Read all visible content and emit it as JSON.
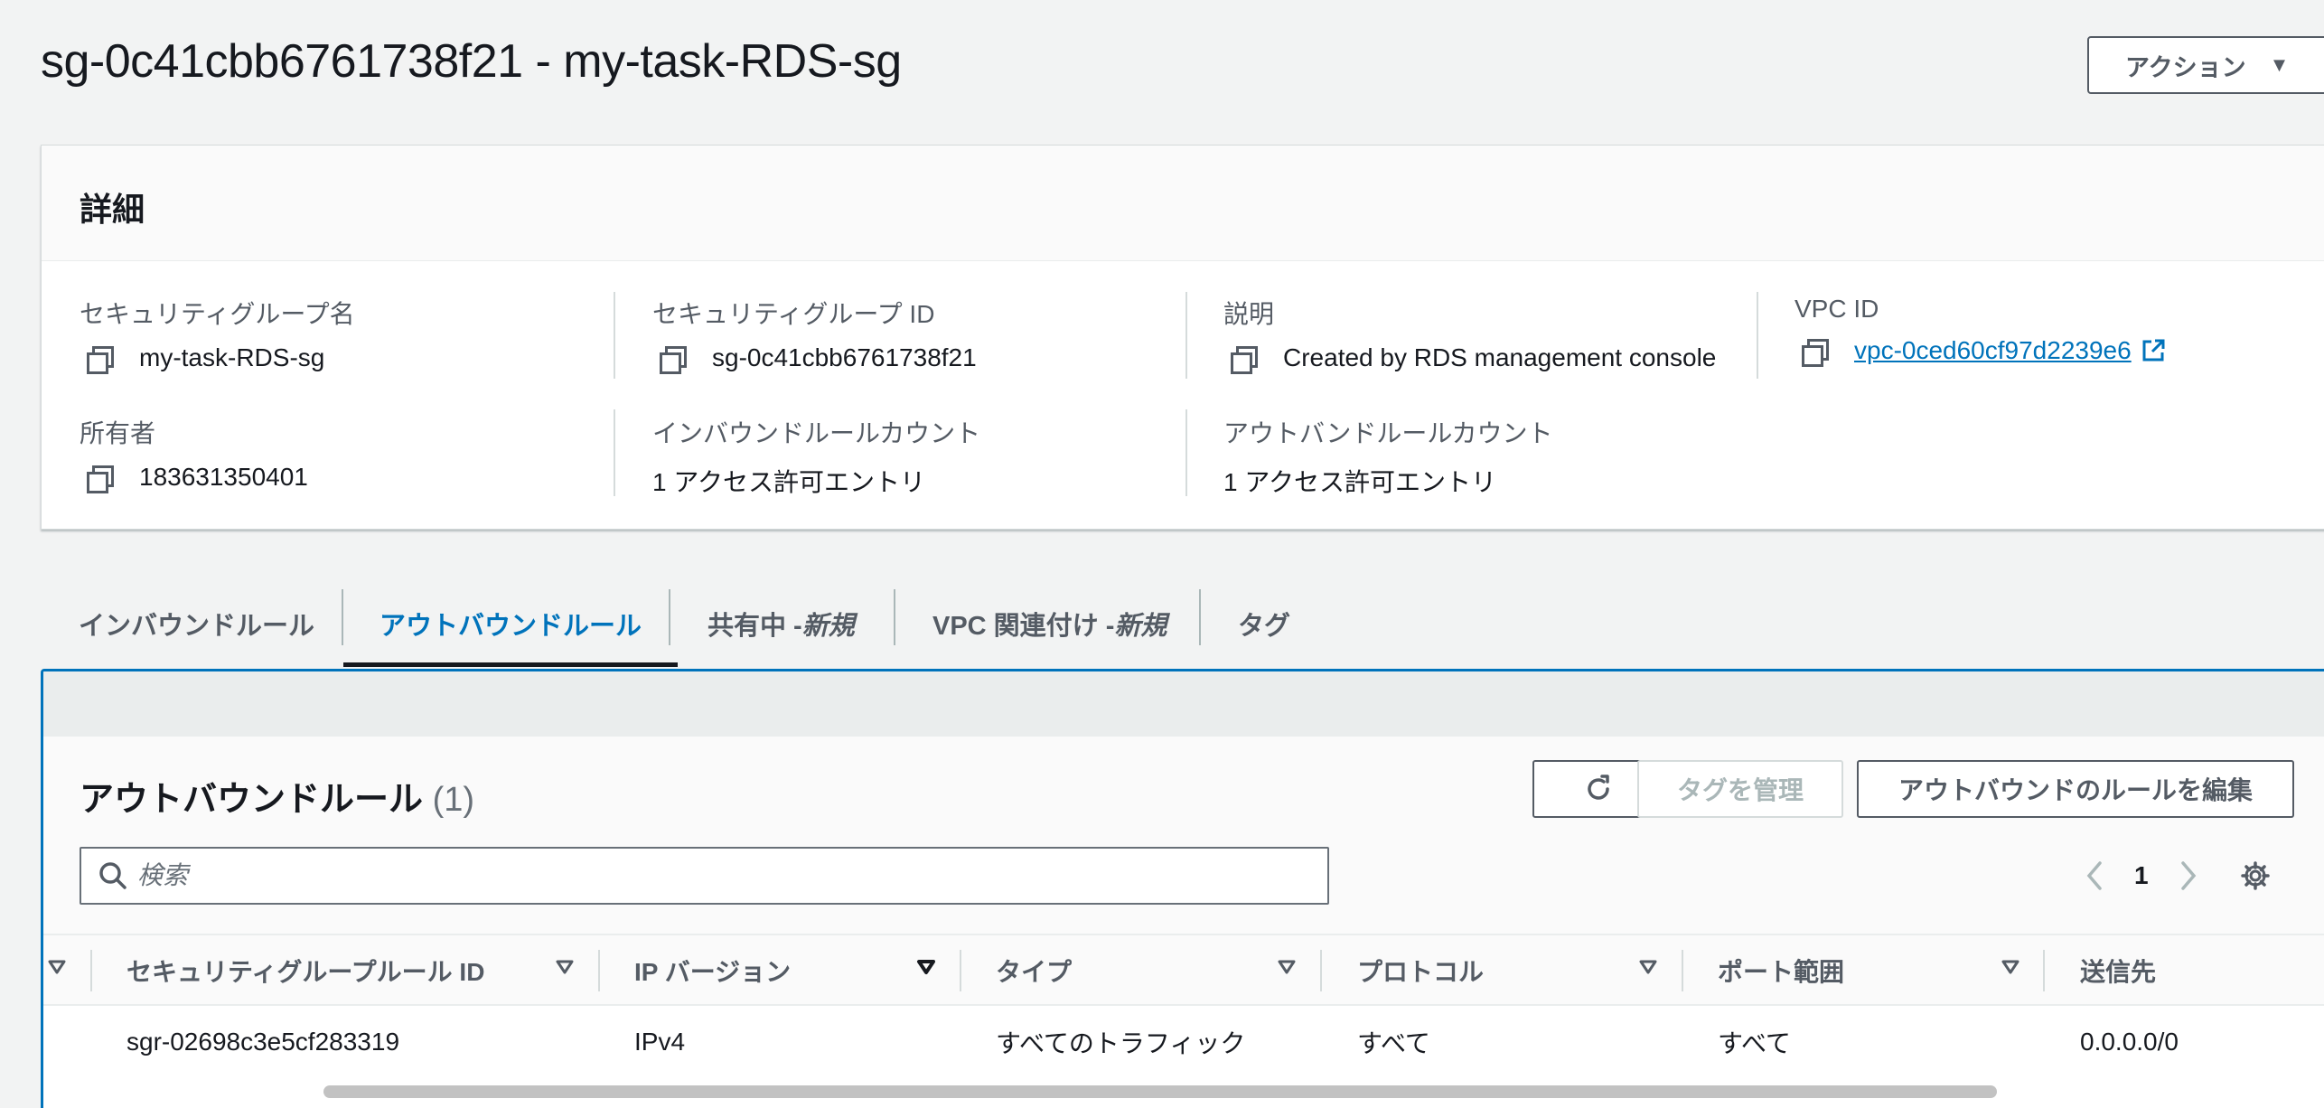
{
  "page": {
    "title": "sg-0c41cbb6761738f21 - my-task-RDS-sg"
  },
  "actions_button": {
    "label": "アクション"
  },
  "details": {
    "heading": "詳細",
    "fields": [
      {
        "label": "セキュリティグループ名",
        "value": "my-task-RDS-sg"
      },
      {
        "label": "セキュリティグループ ID",
        "value": "sg-0c41cbb6761738f21"
      },
      {
        "label": "説明",
        "value": "Created by RDS management console"
      },
      {
        "label": "VPC ID",
        "value": "vpc-0ced60cf97d2239e6"
      },
      {
        "label": "所有者",
        "value": "183631350401"
      },
      {
        "label": "インバウンドルールカウント",
        "value": "1 アクセス許可エントリ"
      },
      {
        "label": "アウトバンドルールカウント",
        "value": "1 アクセス許可エントリ"
      }
    ]
  },
  "tabs": [
    {
      "label": "インバウンドルール"
    },
    {
      "label": "アウトバウンドルール"
    },
    {
      "label": "共有中 - ",
      "badge": "新規"
    },
    {
      "label": "VPC 関連付け - ",
      "badge": "新規"
    },
    {
      "label": "タグ"
    }
  ],
  "outbound": {
    "title": "アウトバウンドルール",
    "count": "(1)",
    "manage_tags_label": "タグを管理",
    "edit_rules_label": "アウトバウンドのルールを編集",
    "search_placeholder": "検索",
    "page_number": "1",
    "columns": [
      "セキュリティグループルール ID",
      "IP バージョン",
      "タイプ",
      "プロトコル",
      "ポート範囲",
      "送信先"
    ],
    "rows": [
      [
        "sgr-02698c3e5cf283319",
        "IPv4",
        "すべてのトラフィック",
        "すべて",
        "すべて",
        "0.0.0.0/0"
      ]
    ]
  },
  "colors": {
    "link": "#0073bb",
    "active_panel_border": "#0073bb",
    "text": "#16191f",
    "muted": "#545b64"
  }
}
